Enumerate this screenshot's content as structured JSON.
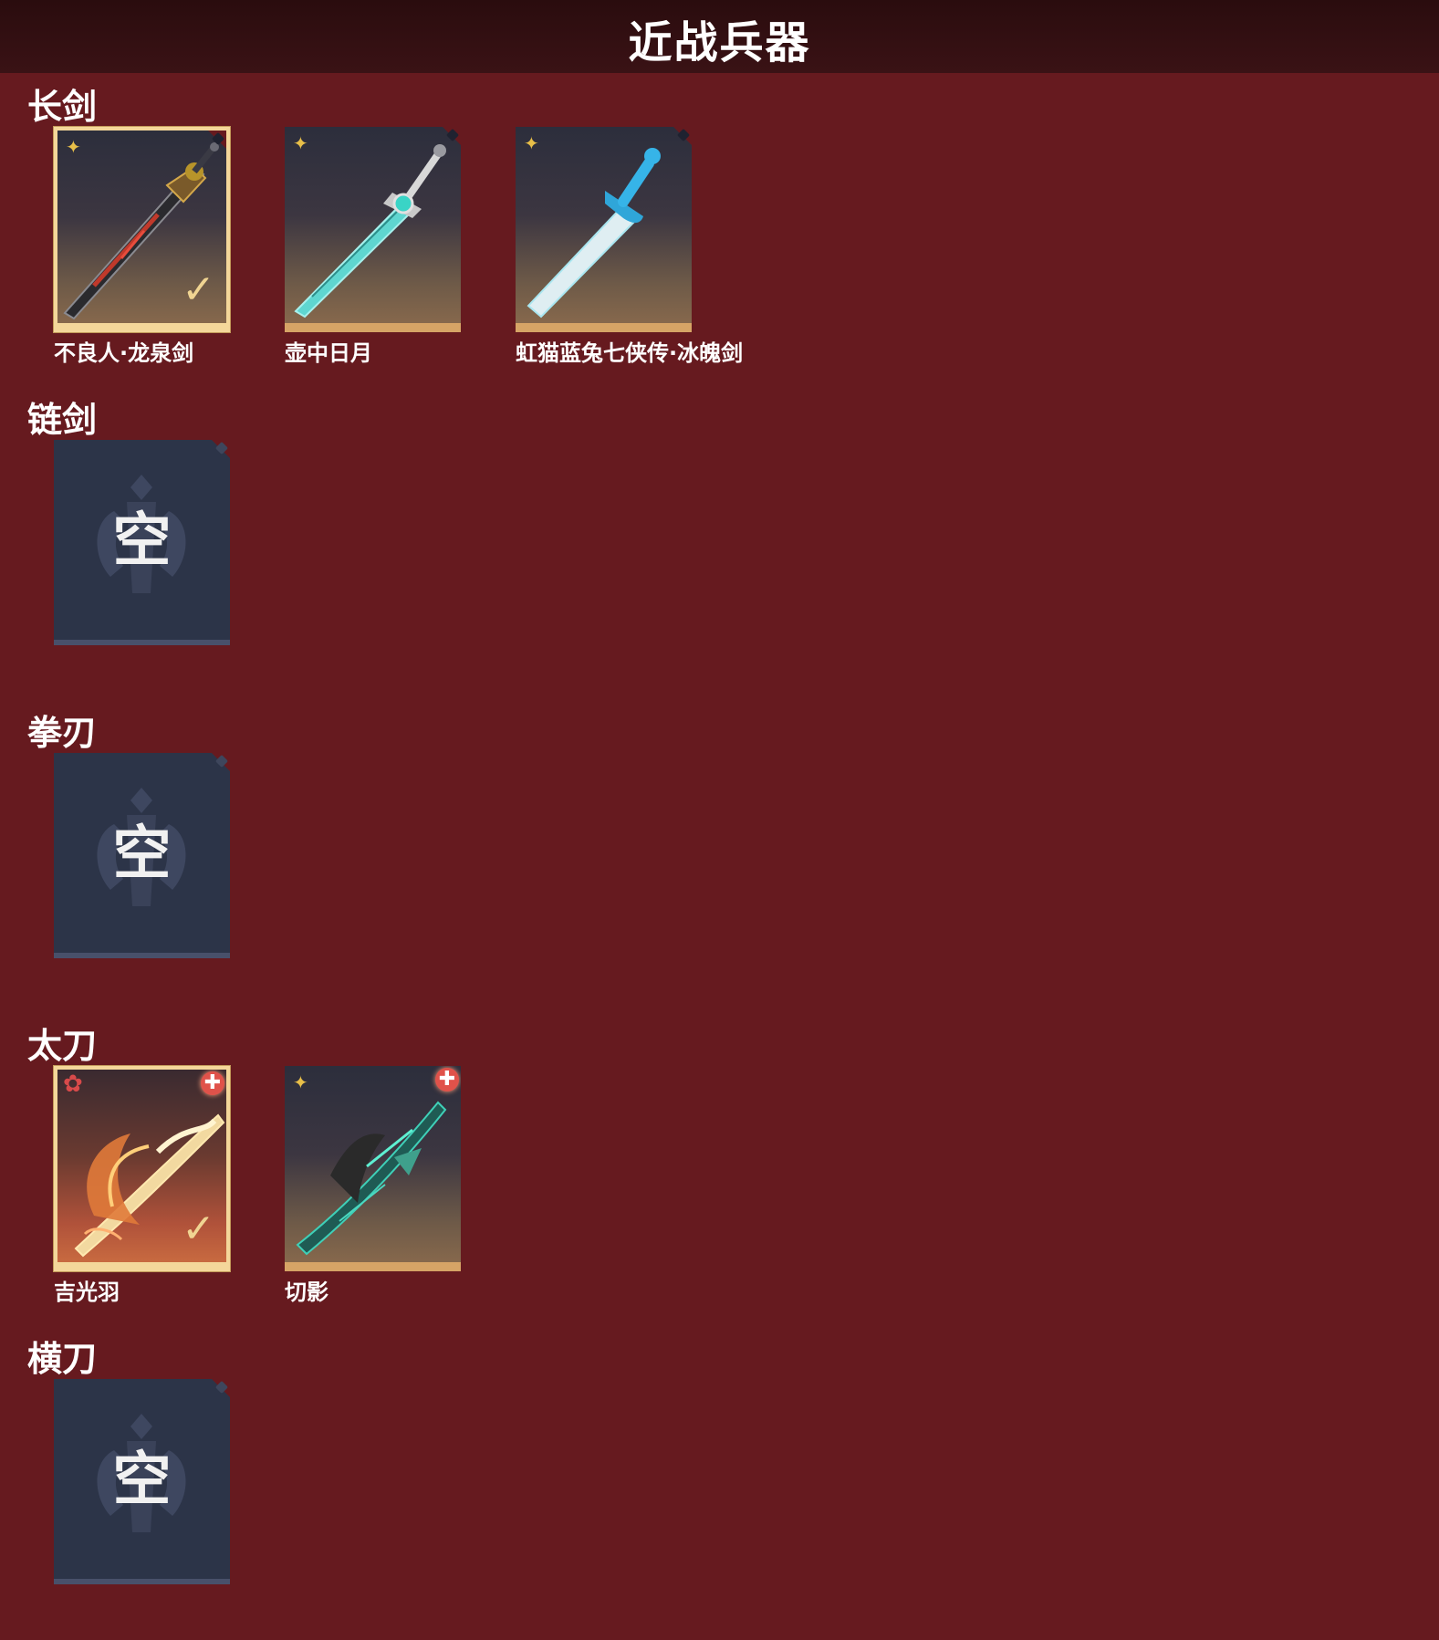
{
  "header": {
    "title": "近战兵器"
  },
  "sections": [
    {
      "title": "长剑",
      "items": [
        {
          "name": "不良人·龙泉剑",
          "rarity_icon": "gold-star-icon",
          "selected": true
        },
        {
          "name": "壶中日月",
          "rarity_icon": "gold-star-icon",
          "selected": false
        },
        {
          "name": "虹猫蓝兔七侠传·冰魄剑",
          "rarity_icon": "gold-star-icon",
          "selected": false
        }
      ]
    },
    {
      "title": "链剑",
      "items": [
        {
          "empty_label": "空"
        }
      ]
    },
    {
      "title": "拳刃",
      "items": [
        {
          "empty_label": "空"
        }
      ]
    },
    {
      "title": "太刀",
      "items": [
        {
          "name": "吉光羽",
          "rarity_icon": "red-flower-icon",
          "selected": true,
          "badge": "plus-badge-icon"
        },
        {
          "name": "切影",
          "rarity_icon": "gold-star-icon",
          "selected": false,
          "badge": "plus-badge-icon"
        }
      ]
    },
    {
      "title": "横刀",
      "items": [
        {
          "empty_label": "空"
        }
      ]
    }
  ],
  "colors": {
    "background": "#661a1f",
    "header": "#2a0c0e",
    "card_accent": "#d6a466",
    "selected_border": "#f4d79a",
    "empty_card": "#2c3448"
  }
}
